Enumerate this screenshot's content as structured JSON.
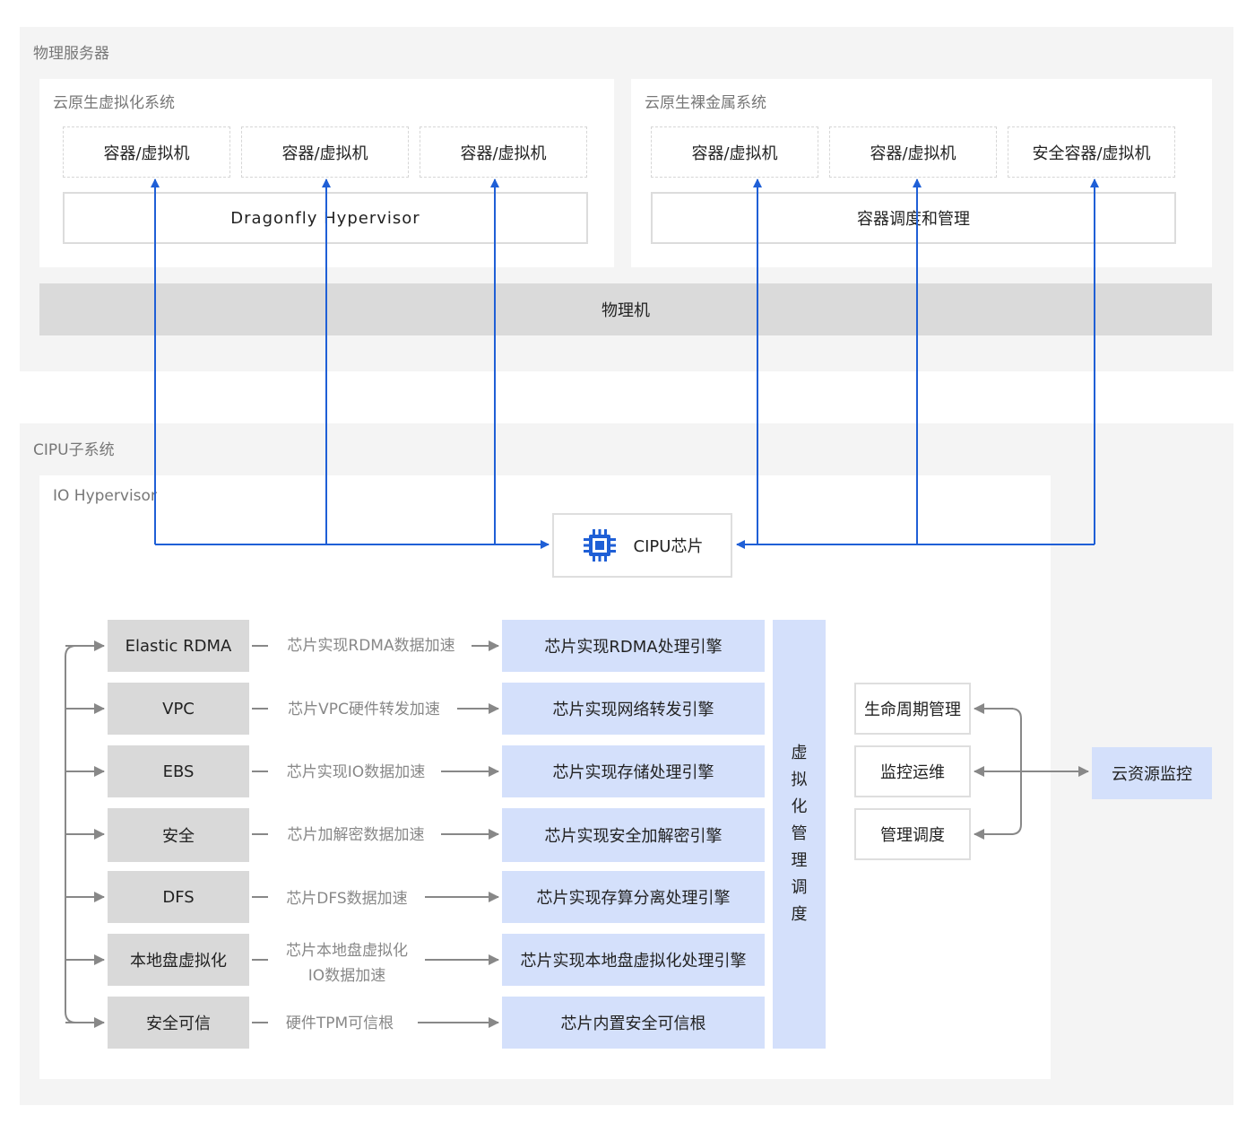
{
  "physical_server": {
    "title": "物理服务器",
    "cloud_virt": {
      "title": "云原生虚拟化系统",
      "boxes": [
        "容器/虚拟机",
        "容器/虚拟机",
        "容器/虚拟机"
      ],
      "hypervisor": "Dragonfly Hypervisor"
    },
    "bare_metal": {
      "title": "云原生裸金属系统",
      "boxes": [
        "容器/虚拟机",
        "容器/虚拟机",
        "安全容器/虚拟机"
      ],
      "scheduler": "容器调度和管理"
    },
    "physical_machine": "物理机"
  },
  "cipu_subsystem": {
    "title": "CIPU子系统",
    "io_hypervisor": "IO Hypervisor",
    "chip_label": "CIPU芯片",
    "chip_icon": "chip-icon",
    "services": [
      {
        "name": "Elastic RDMA",
        "accel": [
          "芯片实现RDMA数据加速"
        ],
        "engine": "芯片实现RDMA处理引擎"
      },
      {
        "name": "VPC",
        "accel": [
          "芯片VPC硬件转发加速"
        ],
        "engine": "芯片实现网络转发引擎"
      },
      {
        "name": "EBS",
        "accel": [
          "芯片实现IO数据加速"
        ],
        "engine": "芯片实现存储处理引擎"
      },
      {
        "name": "安全",
        "accel": [
          "芯片加解密数据加速"
        ],
        "engine": "芯片实现安全加解密引擎"
      },
      {
        "name": "DFS",
        "accel": [
          "芯片DFS数据加速"
        ],
        "engine": "芯片实现存算分离处理引擎"
      },
      {
        "name": "本地盘虚拟化",
        "accel": [
          "芯片本地盘虚拟化",
          "IO数据加速"
        ],
        "engine": "芯片实现本地盘虚拟化处理引擎"
      },
      {
        "name": "安全可信",
        "accel": [
          "硬件TPM可信根"
        ],
        "engine": "芯片内置安全可信根"
      }
    ],
    "virt_mgmt": [
      "虚",
      "拟",
      "化",
      "管",
      "理",
      "调",
      "度"
    ],
    "mgmt_boxes": [
      "生命周期管理",
      "监控运维",
      "管理调度"
    ],
    "resource_monitor": "云资源监控"
  },
  "colors": {
    "arrow_blue": "#1f5fd6",
    "engine_blue": "#d4e0fb",
    "service_gray": "#d9d9d9",
    "arrow_gray": "#888888"
  }
}
